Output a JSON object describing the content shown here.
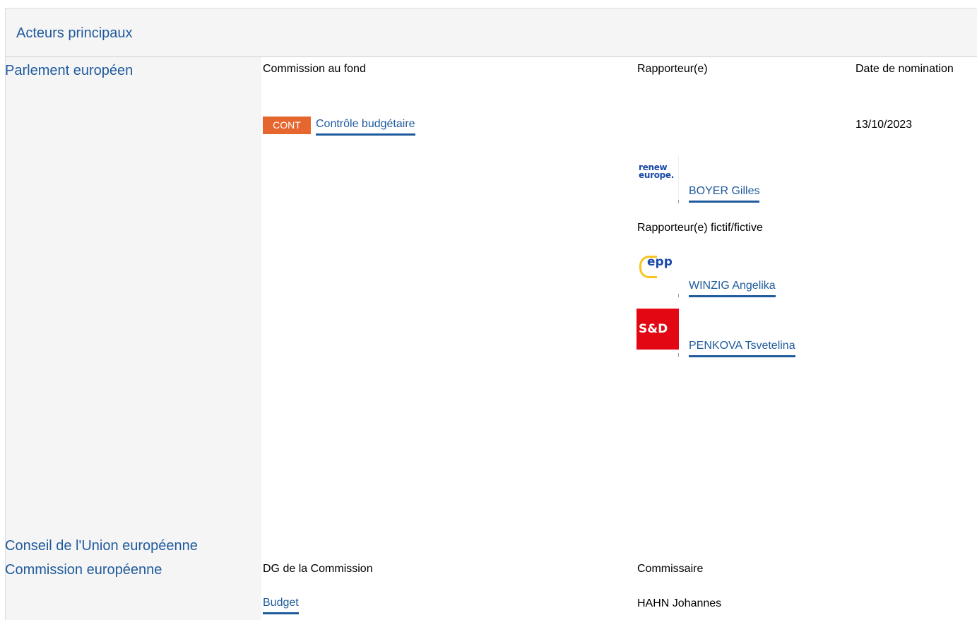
{
  "section_title": "Acteurs principaux",
  "parliament": {
    "name": "Parlement européen",
    "col_committee": "Commission au fond",
    "col_rapporteur": "Rapporteur(e)",
    "col_date": "Date de nomination",
    "committee_code": "CONT",
    "committee_name": "Contrôle budgétaire",
    "date": "13/10/2023",
    "rapporteur": {
      "group_logo": "renew-europe-logo",
      "logo_text": "renew europe.",
      "name": "BOYER Gilles"
    },
    "shadow_label": "Rapporteur(e) fictif/fictive",
    "shadows": [
      {
        "group_logo": "epp-logo",
        "logo_text": "epp",
        "name": "WINZIG Angelika"
      },
      {
        "group_logo": "sd-logo",
        "logo_text": "S&D",
        "name": "PENKOVA Tsvetelina"
      }
    ]
  },
  "council": {
    "name": "Conseil de l'Union européenne"
  },
  "commission": {
    "name": "Commission européenne",
    "col_dg": "DG de la Commission",
    "col_commissioner": "Commissaire",
    "dg": "Budget",
    "commissioner": "HAHN Johannes"
  },
  "colors": {
    "link": "#1f5a9c",
    "badge": "#e5662f",
    "panel": "#f5f5f5",
    "sd_red": "#e30613"
  }
}
